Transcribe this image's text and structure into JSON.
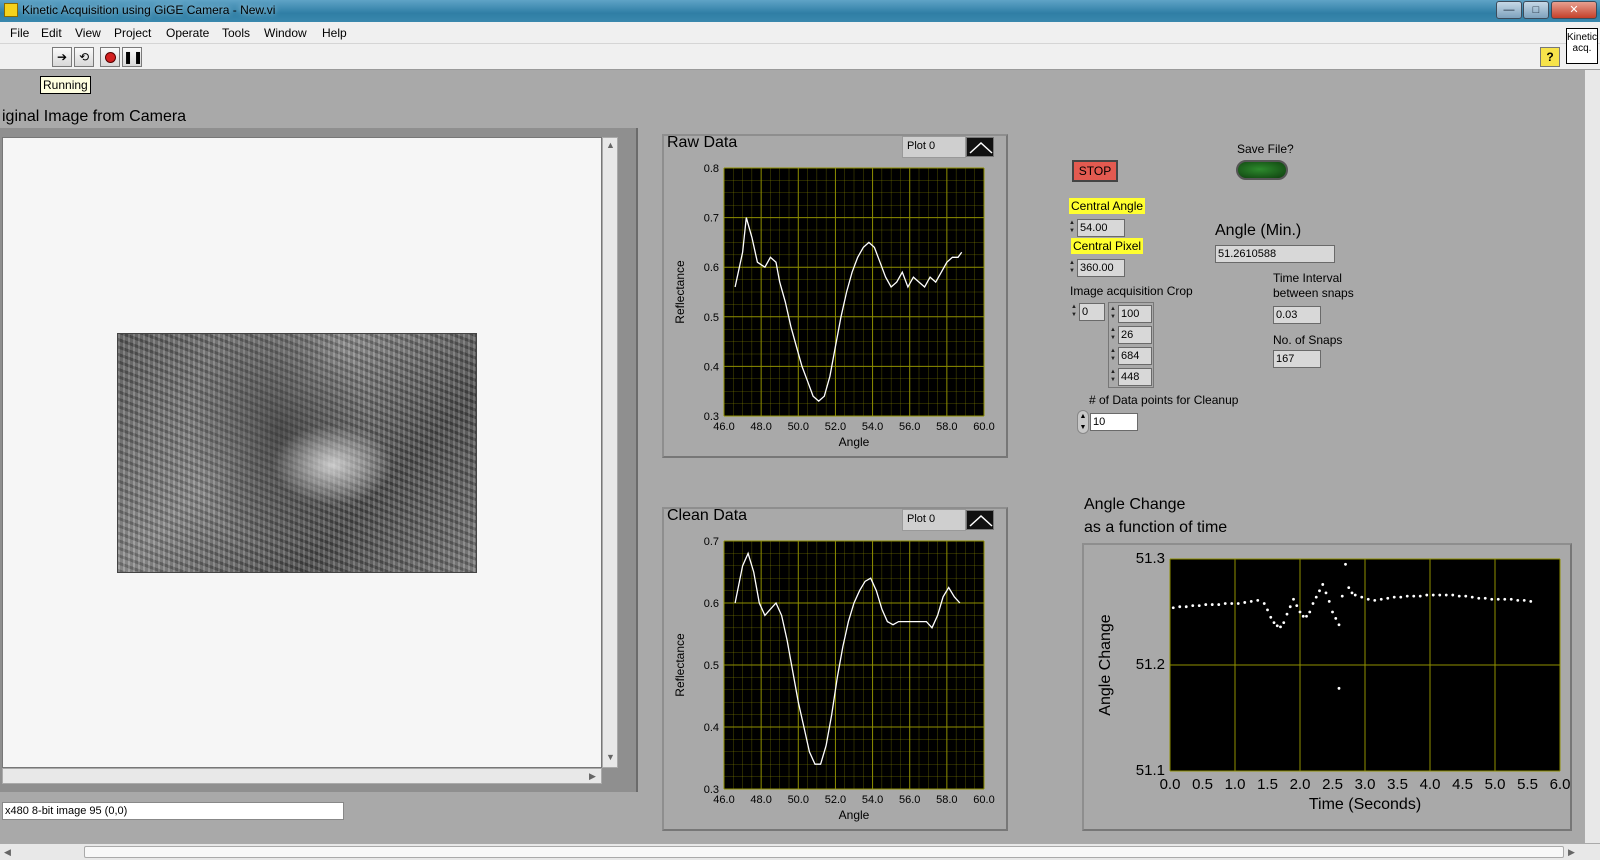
{
  "window": {
    "title": "Kinetic Acquisition using GiGE Camera - New.vi",
    "min": "—",
    "max": "□",
    "close": "✕"
  },
  "menu": [
    "File",
    "Edit",
    "View",
    "Project",
    "Operate",
    "Tools",
    "Window",
    "Help"
  ],
  "toolbar": {
    "run_icon": "run-arrow-icon",
    "help": "?",
    "vi_icon_text": "Kinetic acq."
  },
  "status": {
    "running": "Running"
  },
  "image_display": {
    "title": "iginal Image from Camera",
    "info": "x480 8-bit image 95    (0,0)"
  },
  "raw_graph": {
    "title": "Raw Data",
    "legend": "Plot 0",
    "xlabel": "Angle",
    "ylabel": "Reflectance",
    "xticks": [
      "46.0",
      "48.0",
      "50.0",
      "52.0",
      "54.0",
      "56.0",
      "58.0",
      "60.0"
    ],
    "yticks": [
      "0.8",
      "0.7",
      "0.6",
      "0.5",
      "0.4",
      "0.3"
    ]
  },
  "clean_graph": {
    "title": "Clean Data",
    "legend": "Plot 0",
    "xlabel": "Angle",
    "ylabel": "Reflectance",
    "xticks": [
      "46.0",
      "48.0",
      "50.0",
      "52.0",
      "54.0",
      "56.0",
      "58.0",
      "60.0"
    ],
    "yticks": [
      "0.7",
      "0.6",
      "0.5",
      "0.4",
      "0.3"
    ]
  },
  "angle_graph": {
    "title_line1": "Angle Change",
    "title_line2": "as a function of time",
    "xlabel": "Time (Seconds)",
    "ylabel": "Angle Change",
    "xticks": [
      "0.0",
      "0.5",
      "1.0",
      "1.5",
      "2.0",
      "2.5",
      "3.0",
      "3.5",
      "4.0",
      "4.5",
      "5.0",
      "5.5",
      "6.0"
    ],
    "yticks": [
      "51.3",
      "51.2",
      "51.1"
    ]
  },
  "controls": {
    "stop": "STOP",
    "save_file_label": "Save File?",
    "central_angle_label": "Central Angle",
    "central_angle": "54.00",
    "central_pixel_label": "Central Pixel",
    "central_pixel": "360.00",
    "crop_label": "Image acquisition Crop",
    "crop_index": "0",
    "crop_values": [
      "100",
      "26",
      "684",
      "448"
    ],
    "cleanup_label": "# of Data points for Cleanup",
    "cleanup": "10",
    "angle_min_label": "Angle (Min.)",
    "angle_min": "51.2610588",
    "interval_label_1": "Time Interval",
    "interval_label_2": "between snaps",
    "interval": "0.03",
    "snaps_label": "No. of Snaps",
    "snaps": "167"
  },
  "colors": {
    "plot_bg": "#000000",
    "grid": "#8f8f00",
    "trace": "#ffffff",
    "stop": "#e35a50",
    "highlight": "#ffff30"
  },
  "chart_data": [
    {
      "type": "line",
      "title": "Raw Data",
      "xlabel": "Angle",
      "ylabel": "Reflectance",
      "xlim": [
        46.0,
        60.0
      ],
      "ylim": [
        0.3,
        0.8
      ],
      "series": [
        {
          "x": [
            46.6,
            47.0,
            47.2,
            47.5,
            47.8,
            48.2,
            48.5,
            48.8,
            49.0,
            49.3,
            49.6,
            49.9,
            50.2,
            50.5,
            50.8,
            51.1,
            51.4,
            51.7,
            52.0,
            52.3,
            52.6,
            52.9,
            53.2,
            53.5,
            53.8,
            54.1,
            54.4,
            54.7,
            55.0,
            55.3,
            55.6,
            55.9,
            56.2,
            56.5,
            56.8,
            57.1,
            57.4,
            57.7,
            58.0,
            58.3,
            58.6,
            58.8
          ],
          "y": [
            0.56,
            0.63,
            0.7,
            0.66,
            0.61,
            0.6,
            0.62,
            0.61,
            0.57,
            0.53,
            0.48,
            0.44,
            0.4,
            0.37,
            0.34,
            0.33,
            0.34,
            0.38,
            0.44,
            0.5,
            0.55,
            0.59,
            0.62,
            0.64,
            0.65,
            0.64,
            0.61,
            0.58,
            0.56,
            0.57,
            0.59,
            0.56,
            0.58,
            0.57,
            0.56,
            0.58,
            0.57,
            0.59,
            0.61,
            0.62,
            0.62,
            0.63
          ]
        }
      ]
    },
    {
      "type": "line",
      "title": "Clean Data",
      "xlabel": "Angle",
      "ylabel": "Reflectance",
      "xlim": [
        46.0,
        60.0
      ],
      "ylim": [
        0.3,
        0.7
      ],
      "series": [
        {
          "x": [
            46.6,
            47.0,
            47.3,
            47.6,
            47.9,
            48.2,
            48.5,
            48.8,
            49.1,
            49.4,
            49.7,
            50.0,
            50.3,
            50.6,
            50.9,
            51.2,
            51.5,
            51.8,
            52.1,
            52.4,
            52.7,
            53.0,
            53.3,
            53.6,
            53.9,
            54.2,
            54.5,
            54.8,
            55.1,
            55.4,
            55.7,
            56.0,
            56.3,
            56.6,
            56.9,
            57.2,
            57.5,
            57.8,
            58.1,
            58.4,
            58.7
          ],
          "y": [
            0.6,
            0.66,
            0.68,
            0.65,
            0.6,
            0.58,
            0.59,
            0.6,
            0.58,
            0.54,
            0.49,
            0.44,
            0.4,
            0.36,
            0.34,
            0.34,
            0.37,
            0.42,
            0.48,
            0.53,
            0.57,
            0.6,
            0.62,
            0.635,
            0.64,
            0.62,
            0.59,
            0.57,
            0.565,
            0.57,
            0.57,
            0.57,
            0.57,
            0.57,
            0.57,
            0.56,
            0.58,
            0.61,
            0.625,
            0.61,
            0.6
          ]
        }
      ]
    },
    {
      "type": "scatter",
      "title": "Angle Change as a function of time",
      "xlabel": "Time (Seconds)",
      "ylabel": "Angle Change",
      "xlim": [
        0.0,
        6.0
      ],
      "ylim": [
        51.1,
        51.3
      ],
      "series": [
        {
          "x": [
            0.05,
            0.15,
            0.25,
            0.35,
            0.45,
            0.55,
            0.65,
            0.75,
            0.85,
            0.95,
            1.05,
            1.15,
            1.25,
            1.35,
            1.45,
            1.5,
            1.55,
            1.6,
            1.65,
            1.7,
            1.75,
            1.8,
            1.85,
            1.9,
            1.95,
            2.0,
            2.05,
            2.1,
            2.15,
            2.2,
            2.25,
            2.3,
            2.35,
            2.4,
            2.45,
            2.5,
            2.55,
            2.6,
            2.6,
            2.65,
            2.7,
            2.75,
            2.8,
            2.85,
            2.95,
            3.05,
            3.15,
            3.25,
            3.35,
            3.45,
            3.55,
            3.65,
            3.75,
            3.85,
            3.95,
            4.05,
            4.15,
            4.25,
            4.35,
            4.45,
            4.55,
            4.65,
            4.75,
            4.85,
            4.95,
            5.05,
            5.15,
            5.25,
            5.35,
            5.45,
            5.55
          ],
          "y": [
            51.254,
            51.255,
            51.255,
            51.256,
            51.256,
            51.257,
            51.257,
            51.257,
            51.258,
            51.258,
            51.258,
            51.259,
            51.26,
            51.261,
            51.258,
            51.252,
            51.245,
            51.24,
            51.237,
            51.236,
            51.24,
            51.248,
            51.255,
            51.262,
            51.256,
            51.25,
            51.246,
            51.246,
            51.25,
            51.258,
            51.264,
            51.27,
            51.276,
            51.268,
            51.26,
            51.25,
            51.244,
            51.238,
            51.178,
            51.265,
            51.295,
            51.273,
            51.268,
            51.266,
            51.264,
            51.262,
            51.261,
            51.262,
            51.263,
            51.264,
            51.264,
            51.265,
            51.265,
            51.265,
            51.266,
            51.266,
            51.266,
            51.266,
            51.266,
            51.265,
            51.265,
            51.264,
            51.263,
            51.263,
            51.262,
            51.262,
            51.262,
            51.262,
            51.261,
            51.261,
            51.26
          ]
        }
      ]
    }
  ]
}
